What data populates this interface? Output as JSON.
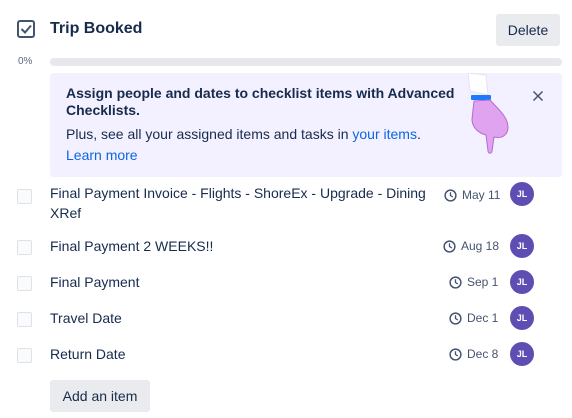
{
  "checklist": {
    "title": "Trip Booked",
    "delete_label": "Delete",
    "progress_label": "0%",
    "progress_fraction": 0
  },
  "promo": {
    "heading": "Assign people and dates to checklist items with Advanced Checklists.",
    "body_prefix": "Plus, see all your assigned items and tasks in ",
    "body_link": "your items",
    "body_suffix": ".",
    "learn_more": "Learn more",
    "close_icon": "close-icon",
    "illustration": "pointing-hand-illustration"
  },
  "items": [
    {
      "text": "Final Payment Invoice - Flights - ShoreEx - Upgrade - Dining XRef",
      "due": "May 11",
      "assignee": "JL"
    },
    {
      "text": "Final Payment 2 WEEKS!!",
      "due": "Aug 18",
      "assignee": "JL"
    },
    {
      "text": "Final Payment",
      "due": "Sep 1",
      "assignee": "JL"
    },
    {
      "text": "Travel Date",
      "due": "Dec 1",
      "assignee": "JL"
    },
    {
      "text": "Return Date",
      "due": "Dec 8",
      "assignee": "JL"
    }
  ],
  "add_item_label": "Add an item",
  "colors": {
    "avatar": "#5e4db2",
    "promo_bg": "#f3f0ff",
    "link": "#0c66e4",
    "button_bg": "#e9ebee"
  }
}
